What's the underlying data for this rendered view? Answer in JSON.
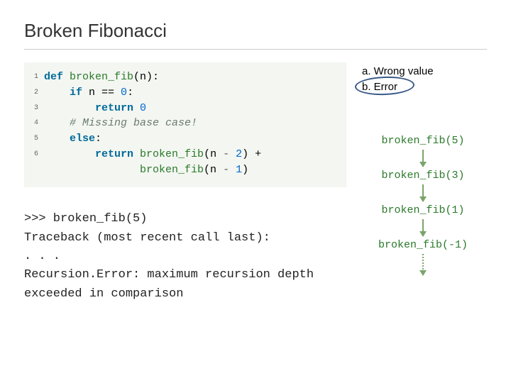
{
  "title": "Broken Fibonacci",
  "code": {
    "linenos": [
      "1",
      "2",
      "3",
      "4",
      "5",
      "6"
    ],
    "l1_kw1": "def",
    "l1_fn": "broken_fib",
    "l1_rest1": "(n):",
    "l2_kw": "if",
    "l2_rest": " n == ",
    "l2_num": "0",
    "l2_colon": ":",
    "l3_kw": "return",
    "l3_num": "0",
    "l4_cmt": "# Missing base case!",
    "l5_kw": "else",
    "l5_colon": ":",
    "l6_kw": "return",
    "l6_fn1": "broken_fib",
    "l6_p1": "(n ",
    "l6_op1": "-",
    "l6_sp1": " ",
    "l6_n2": "2",
    "l6_plus": ") +",
    "l7_fn": "broken_fib",
    "l7_p": "(n ",
    "l7_op": "-",
    "l7_sp": " ",
    "l7_n": "1",
    "l7_close": ")"
  },
  "repl": ">>> broken_fib(5)\nTraceback (most recent call last):\n. . .\nRecursion.Error: maximum recursion depth exceeded in comparison",
  "choices": {
    "a": "a. Wrong value",
    "b": "b. Error"
  },
  "calls": {
    "c1": "broken_fib(5)",
    "c2": "broken_fib(3)",
    "c3": "broken_fib(1)",
    "c4": "broken_fib(-1)"
  }
}
